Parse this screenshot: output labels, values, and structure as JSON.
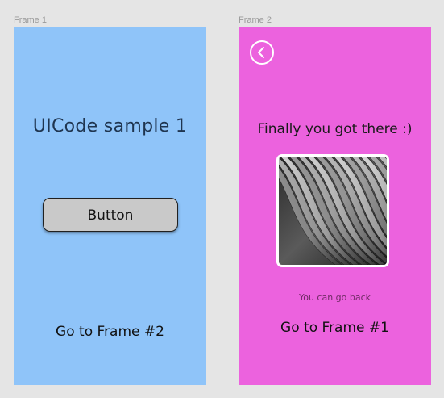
{
  "colors": {
    "canvas": "#e5e5e5",
    "frame1_bg": "#8fc4f9",
    "frame2_bg": "#ec62de",
    "button_bg": "#c9c9c9"
  },
  "frame1": {
    "label": "Frame 1",
    "title": "UICode sample 1",
    "button_label": "Button",
    "link": "Go to Frame #2"
  },
  "frame2": {
    "label": "Frame 2",
    "back_icon": "chevron-left-circle-icon",
    "heading": "Finally you got there :)",
    "image": "abstract-architecture-photo",
    "caption": "You can go back",
    "link": "Go to Frame #1"
  }
}
